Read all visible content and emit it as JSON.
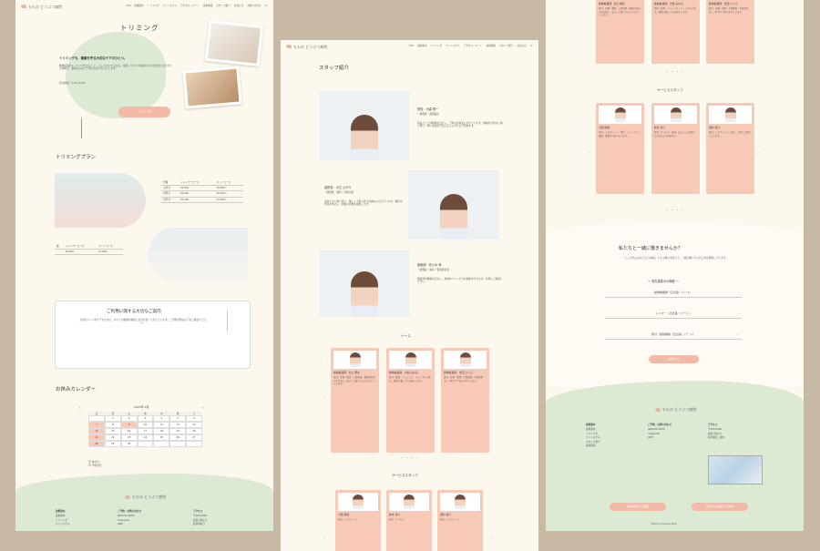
{
  "site": {
    "logo_text": "ももの どうぶつ病院",
    "nav": [
      "TOP",
      "診療案内",
      "トリミング",
      "ペットホテル",
      "アクセス・ルート",
      "採用情報",
      "スタッフ紹介",
      "お知らせ",
      "お問い合わせ"
    ],
    "phone_icon": "phone-icon"
  },
  "left": {
    "title": "トリミング",
    "lead": "トリミングも、健康を守る大切なケアのひとつ。",
    "body": "動物病院のトリミングだからこそ、もしものときも安心。皮膚トラブルや体調の小さな変化にも気づける体制で、愛情を込めて丁寧にお手入れいたします。",
    "hours": "受付時間：9:00-16:00",
    "btn": "プラン一覧",
    "plan_title": "トリミングプラン",
    "plan_headers": [
      "犬種",
      "シャンプーコース",
      "カットコース"
    ],
    "plan_rows": [
      [
        "小型犬",
        "¥3,000",
        "¥5,000〜"
      ],
      [
        "中型犬",
        "¥4,000",
        "¥6,000〜"
      ],
      [
        "大型犬",
        "¥5,000",
        "¥7,000〜"
      ]
    ],
    "cat_headers": [
      "猫",
      "シャンプーコース",
      "カットコース"
    ],
    "cat_row": [
      "¥4,000",
      "¥7,000"
    ],
    "notice_title": "ご利用に関する大切なご案内",
    "notice_body": "大切なペットのケアのために、すべての動物の健康と安全を第一に考えています。ご予約の際は以下をご確認ください。",
    "calendar_title": "お休みカレンダー",
    "calendar_month": "2025年 9月",
    "calendar_days": [
      "日",
      "月",
      "火",
      "水",
      "木",
      "金",
      "土"
    ],
    "calendar_dates": [
      "",
      "1",
      "2",
      "3",
      "4",
      "5",
      "6",
      "7",
      "8",
      "9",
      "10",
      "11",
      "12",
      "13",
      "14",
      "15",
      "16",
      "17",
      "18",
      "19",
      "20",
      "21",
      "22",
      "23",
      "24",
      "25",
      "26",
      "27",
      "28",
      "29",
      "30",
      "",
      "",
      "",
      ""
    ],
    "legend": [
      "休診日",
      "予約状況"
    ],
    "footer_cols": [
      {
        "title": "診療案内",
        "items": [
          "診療案内",
          "トリミング",
          "ペットホテル"
        ]
      },
      {
        "title": "ご予約・お問い合わせ",
        "items": [
          "0000-00-0000",
          "Instagram",
          "LINE"
        ]
      },
      {
        "title": "アクセス",
        "items": [
          "〒000-0000",
          "最寄り駅より",
          "駐車場あり"
        ]
      }
    ]
  },
  "mid": {
    "title": "スタッフ紹介",
    "staff": [
      {
        "role": "院長：大森 陽一",
        "sub": "一級獣医・獣医臨床",
        "text": "院長としての経験を活かし、丁寧な診療を心がけています。動物の気持ちに寄り添い、飼い主様の不安に応えられるよう努めます。"
      },
      {
        "role": "副院長：大島 ひかり",
        "sub": "一級獣医・猫科・手術担当",
        "text": "患者さまに寄り添い、優しくて寄り添う診療を心がけています。猫科や外科を中心に、的確な治療を提供します。"
      },
      {
        "role": "獣医師：佐々木 隼",
        "sub": "一級獣医・歯科・循環器担当",
        "text": "獣医師の経験を活かし、地域のペットたちの健康を守ります。気軽にご相談ください。"
      }
    ],
    "nurse_title": "ナース",
    "nurses": [
      {
        "role": "動物看護師：村上 翔太",
        "text": "担当：診療・看護・入院管理。動物の気持ちを大切に、安心して過ごせるようサポートします。"
      },
      {
        "role": "動物看護師：大嶋 みなみ",
        "text": "担当：看護・トリミング・ペットホテル担当。笑顔と優しさでお迎えします。"
      },
      {
        "role": "動物看護師：吉田 さくら",
        "text": "担当：診療・看護・手術補助・手術室担当。丁寧なケアを心がけています。"
      }
    ],
    "service_title": "サービススタッフ",
    "service": [
      {
        "role": "大西 南穂",
        "text": "担当：レセプション"
      },
      {
        "role": "鈴木 涼介",
        "text": "担当：サービス"
      },
      {
        "role": "西村 和乃",
        "text": "担当：レセプション"
      }
    ]
  },
  "right": {
    "service_title": "サービススタッフ",
    "service": [
      {
        "role": "大西 南穂",
        "text": "担当：レセプション・受付・ペットフード管理。笑顔で対応いたします。"
      },
      {
        "role": "鈴木 涼介",
        "text": "担当：サービス・送迎。安心してご来院いただけるよう努めます。"
      },
      {
        "role": "西村 和乃",
        "text": "担当：レセプション・会計。丁寧にご案内いたします。"
      }
    ],
    "recruit_title": "私たちと一緒に働きませんか？",
    "recruit_body": "「ここがもものどうぶつ病院」そんな思いを持って、一緒に働いてくれる方を募集しています。",
    "jobs_title": "〜 現在募集中の職種 〜",
    "jobs": [
      "動物看護師（正社員・パート）",
      "トリマー（正社員・パート）",
      "受付・動物補助（正社員・パート）"
    ],
    "apply_btn": "応募する",
    "footer_cols": [
      {
        "title": "診療案内",
        "items": [
          "診療案内",
          "トリミング",
          "ペットホテル",
          "スタッフ紹介",
          "採用情報"
        ]
      },
      {
        "title": "ご予約・お問い合わせ",
        "items": [
          "0000-00-0000",
          "Instagram",
          "LINE"
        ]
      },
      {
        "title": "アクセス",
        "items": [
          "〒000-0000",
          "最寄り駅より",
          "駐車場のご案内"
        ]
      }
    ],
    "footer_btn_left": "動物病院をご確認",
    "footer_btn_right": "受付する必要なご案内",
    "copyright": "©Momo no Dobutsu Byoin"
  }
}
